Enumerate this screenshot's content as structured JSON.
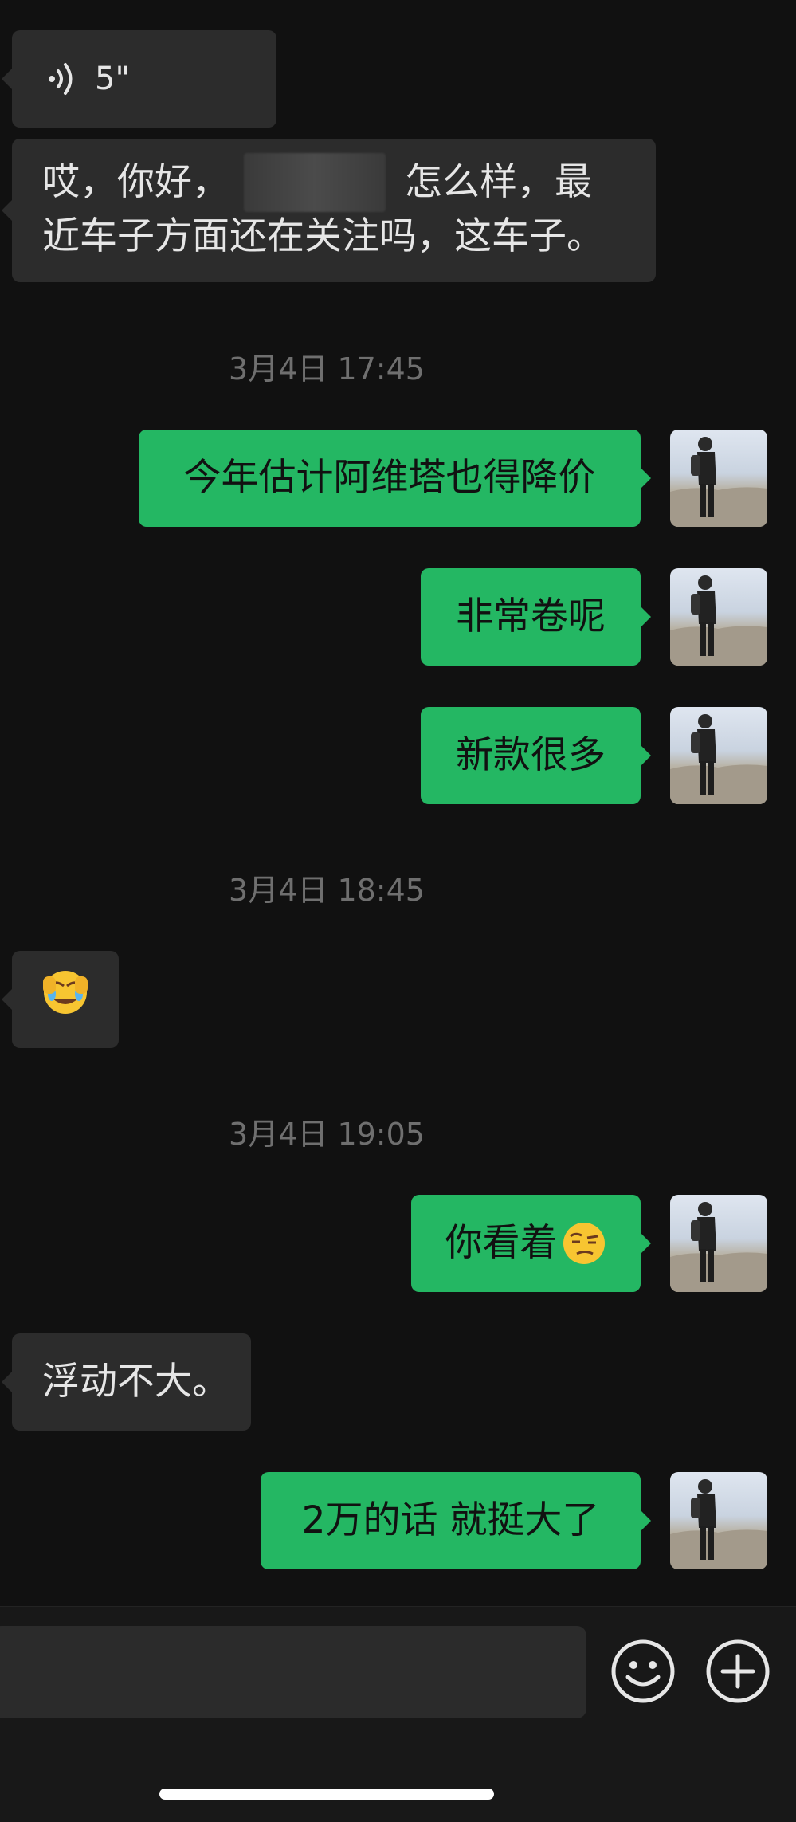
{
  "messages": {
    "voice_duration": "5\"",
    "greeting_part1": "哎，你好，",
    "greeting_part2": "怎么样，最",
    "greeting_line2": "近车子方面还在关注吗，这车子。",
    "price_drop": "今年估计阿维塔也得降价",
    "competitive": "非常卷呢",
    "many_new": "新款很多",
    "you_see": "你看着",
    "small_float": "浮动不大。",
    "big_if_20k": "2万的话 就挺大了"
  },
  "timestamps": {
    "t1": "3月4日 17:45",
    "t2": "3月4日 18:45",
    "t3": "3月4日 19:05"
  },
  "icons": {
    "voice": "voice-wave-icon",
    "facepalm": "facepalm-crying-emoji-icon",
    "skeptical": "skeptical-emoji-icon",
    "emoji_button": "smiley-icon",
    "plus_button": "plus-circle-icon"
  },
  "colors": {
    "background": "#111111",
    "sent_bubble": "#24b763",
    "received_bubble": "#2c2c2c",
    "timestamp": "#6f6f6f"
  }
}
